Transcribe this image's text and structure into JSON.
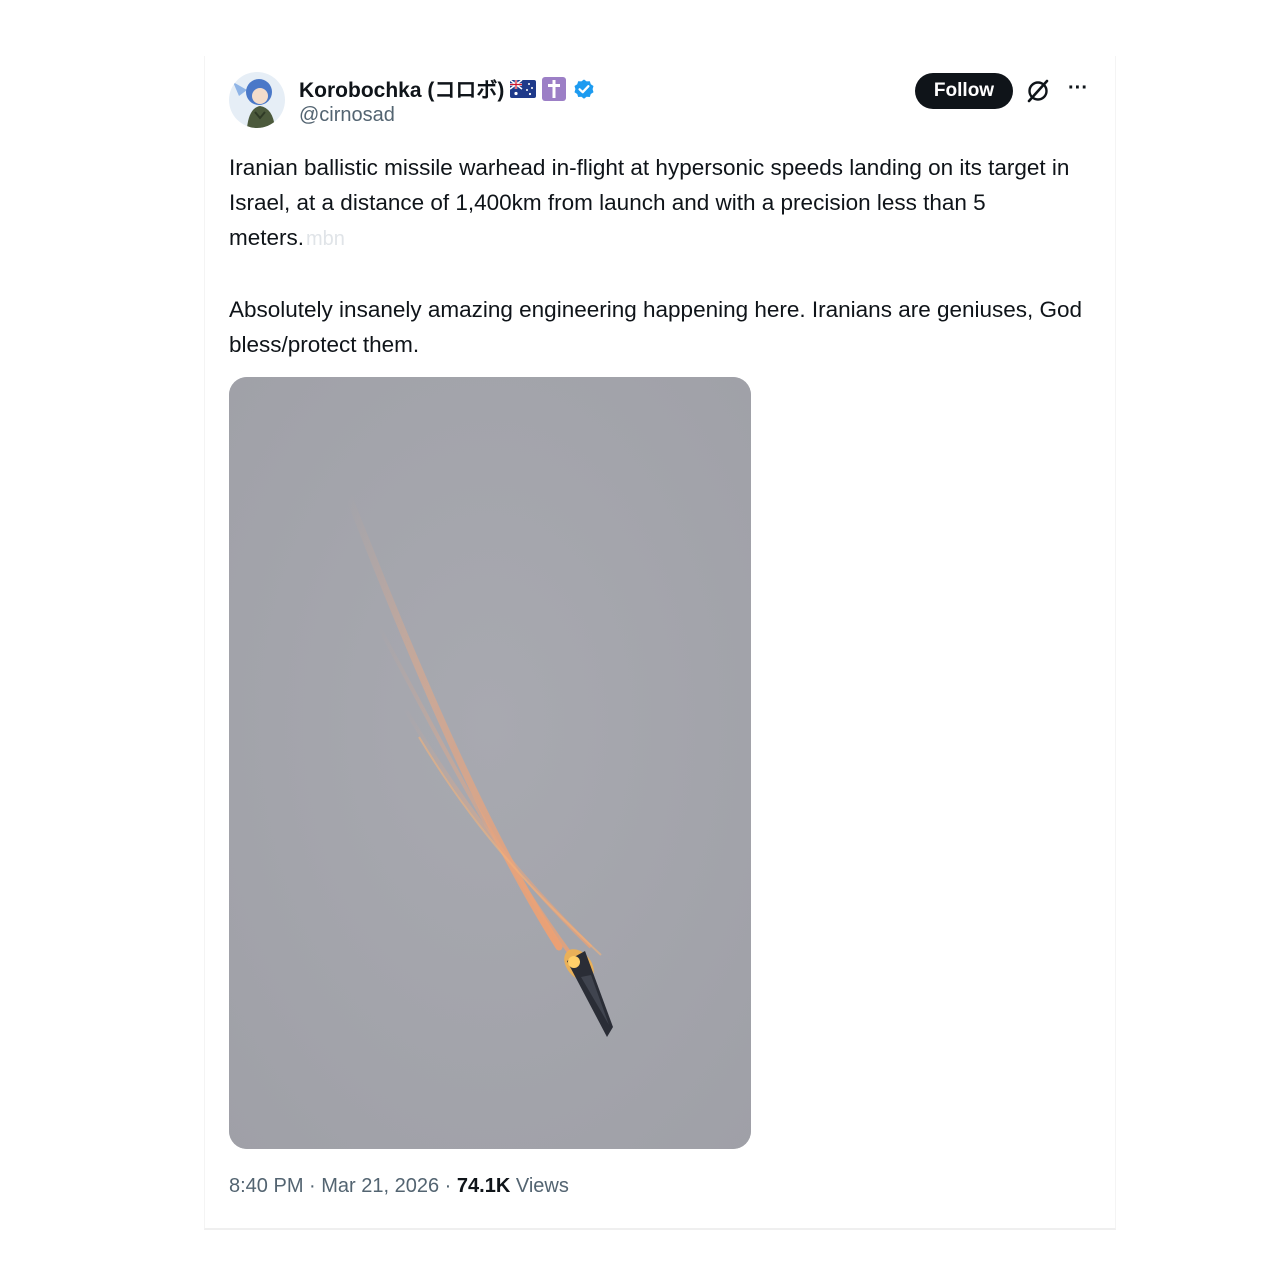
{
  "author": {
    "display_name": "Korobochka (コロボ)",
    "handle": "@cirnosad",
    "badges": [
      "australia-flag-icon",
      "cross-icon",
      "verified-badge-icon"
    ]
  },
  "actions": {
    "follow_label": "Follow",
    "grok_icon": "grok-icon",
    "more_icon": "more-options-icon",
    "more_glyph": "···"
  },
  "tweet": {
    "paragraph_1": "Iranian ballistic missile warhead in-flight at hypersonic speeds landing on its target in Israel, at a distance of 1,400km from launch and with a precision less than 5 meters.",
    "watermark": "mbn",
    "paragraph_2": "Absolutely insanely amazing engineering happening here. Iranians are geniuses, God bless/protect them."
  },
  "media": {
    "description_icon": "missile-photo"
  },
  "meta": {
    "time": "8:40 PM",
    "separator": " · ",
    "date": "Mar 21, 2026",
    "views_count": "74.1K",
    "views_label": "Views"
  },
  "colors": {
    "text_primary": "#0f1419",
    "text_secondary": "#536471",
    "verified_blue": "#1d9bf0",
    "button_dark": "#0f1419",
    "photo_sky": "#a4a5ac"
  }
}
